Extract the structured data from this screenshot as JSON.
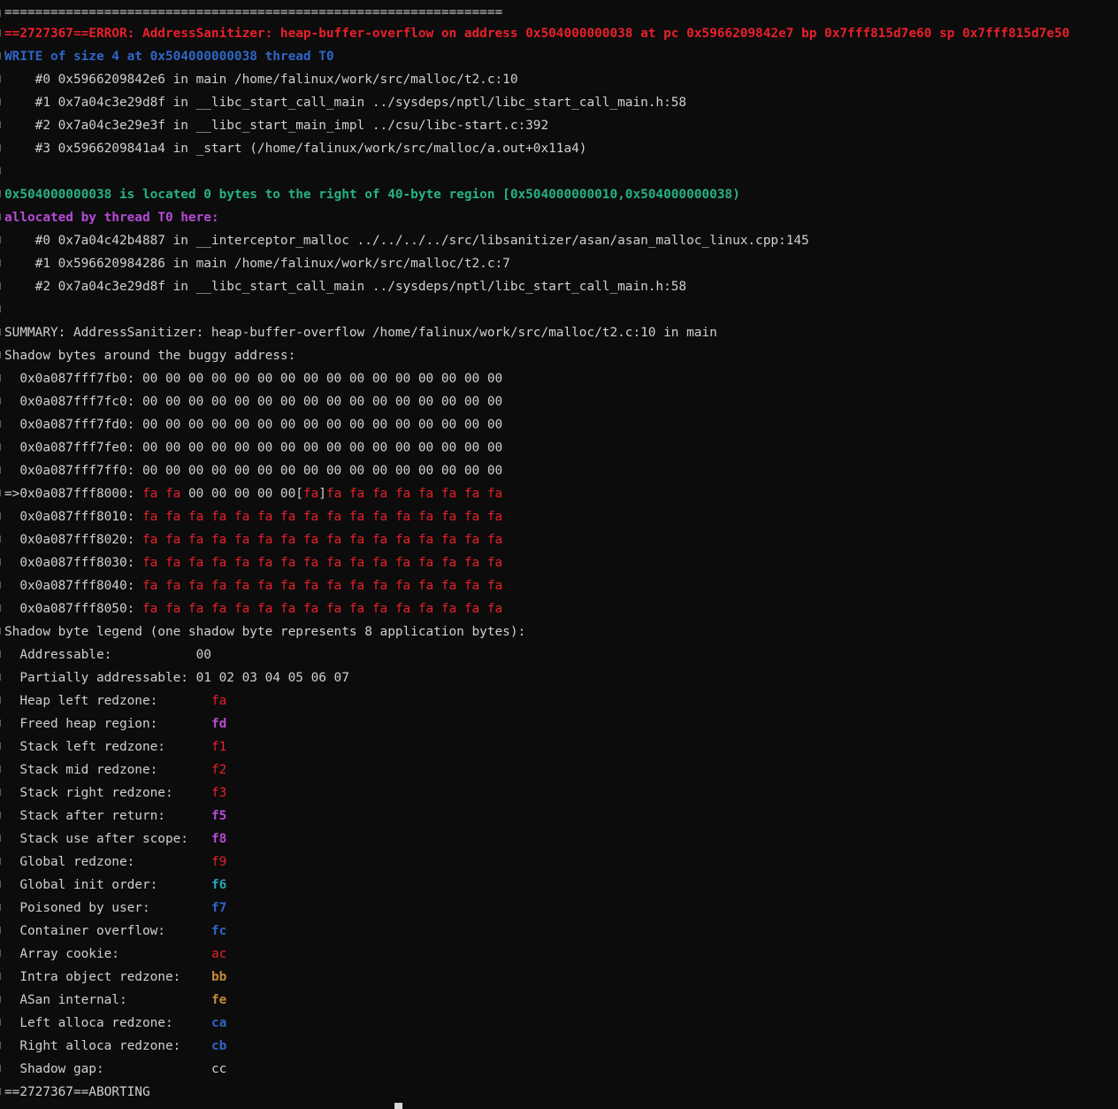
{
  "separator": "=================================================================",
  "error_header": "==2727367==ERROR: AddressSanitizer: heap-buffer-overflow on address 0x504000000038 at pc 0x5966209842e7 bp 0x7fff815d7e60 sp 0x7fff815d7e50",
  "write_line": "WRITE of size 4 at 0x504000000038 thread T0",
  "write_stack": [
    "    #0 0x5966209842e6 in main /home/falinux/work/src/malloc/t2.c:10",
    "    #1 0x7a04c3e29d8f in __libc_start_call_main ../sysdeps/nptl/libc_start_call_main.h:58",
    "    #2 0x7a04c3e29e3f in __libc_start_main_impl ../csu/libc-start.c:392",
    "    #3 0x5966209841a4 in _start (/home/falinux/work/src/malloc/a.out+0x11a4)"
  ],
  "located_line": "0x504000000038 is located 0 bytes to the right of 40-byte region [0x504000000010,0x504000000038)",
  "allocated_line": "allocated by thread T0 here:",
  "alloc_stack": [
    "    #0 0x7a04c42b4887 in __interceptor_malloc ../../../../src/libsanitizer/asan/asan_malloc_linux.cpp:145",
    "    #1 0x596620984286 in main /home/falinux/work/src/malloc/t2.c:7",
    "    #2 0x7a04c3e29d8f in __libc_start_call_main ../sysdeps/nptl/libc_start_call_main.h:58"
  ],
  "summary": "SUMMARY: AddressSanitizer: heap-buffer-overflow /home/falinux/work/src/malloc/t2.c:10 in main",
  "shadow_title": "Shadow bytes around the buggy address:",
  "shadow_zero_rows": [
    "  0x0a087fff7fb0: 00 00 00 00 00 00 00 00 00 00 00 00 00 00 00 00",
    "  0x0a087fff7fc0: 00 00 00 00 00 00 00 00 00 00 00 00 00 00 00 00",
    "  0x0a087fff7fd0: 00 00 00 00 00 00 00 00 00 00 00 00 00 00 00 00",
    "  0x0a087fff7fe0: 00 00 00 00 00 00 00 00 00 00 00 00 00 00 00 00",
    "  0x0a087fff7ff0: 00 00 00 00 00 00 00 00 00 00 00 00 00 00 00 00"
  ],
  "buggy_row": {
    "prefix": "=>0x0a087fff8000: ",
    "fa_start": "fa fa",
    "zeros": " 00 00 00 00 00[",
    "hit": "fa",
    "bracket": "]",
    "fa_rest": "fa fa fa fa fa fa fa fa"
  },
  "shadow_fa_rows": [
    {
      "addr": "  0x0a087fff8010: ",
      "bytes": "fa fa fa fa fa fa fa fa fa fa fa fa fa fa fa fa"
    },
    {
      "addr": "  0x0a087fff8020: ",
      "bytes": "fa fa fa fa fa fa fa fa fa fa fa fa fa fa fa fa"
    },
    {
      "addr": "  0x0a087fff8030: ",
      "bytes": "fa fa fa fa fa fa fa fa fa fa fa fa fa fa fa fa"
    },
    {
      "addr": "  0x0a087fff8040: ",
      "bytes": "fa fa fa fa fa fa fa fa fa fa fa fa fa fa fa fa"
    },
    {
      "addr": "  0x0a087fff8050: ",
      "bytes": "fa fa fa fa fa fa fa fa fa fa fa fa fa fa fa fa"
    }
  ],
  "legend_title": "Shadow byte legend (one shadow byte represents 8 application bytes):",
  "legend": [
    {
      "label": "  Addressable:           ",
      "code": "00",
      "color": "plain"
    },
    {
      "label": "  Partially addressable: ",
      "code": "01 02 03 04 05 06 07",
      "color": "plain"
    },
    {
      "label": "  Heap left redzone:       ",
      "code": "fa",
      "color": "red"
    },
    {
      "label": "  Freed heap region:       ",
      "code": "fd",
      "color": "purple"
    },
    {
      "label": "  Stack left redzone:      ",
      "code": "f1",
      "color": "red"
    },
    {
      "label": "  Stack mid redzone:       ",
      "code": "f2",
      "color": "red"
    },
    {
      "label": "  Stack right redzone:     ",
      "code": "f3",
      "color": "red"
    },
    {
      "label": "  Stack after return:      ",
      "code": "f5",
      "color": "purple"
    },
    {
      "label": "  Stack use after scope:   ",
      "code": "f8",
      "color": "purple"
    },
    {
      "label": "  Global redzone:          ",
      "code": "f9",
      "color": "red"
    },
    {
      "label": "  Global init order:       ",
      "code": "f6",
      "color": "teal"
    },
    {
      "label": "  Poisoned by user:        ",
      "code": "f7",
      "color": "dblue"
    },
    {
      "label": "  Container overflow:      ",
      "code": "fc",
      "color": "dblue"
    },
    {
      "label": "  Array cookie:            ",
      "code": "ac",
      "color": "red"
    },
    {
      "label": "  Intra object redzone:    ",
      "code": "bb",
      "color": "tan"
    },
    {
      "label": "  ASan internal:           ",
      "code": "fe",
      "color": "tan"
    },
    {
      "label": "  Left alloca redzone:     ",
      "code": "ca",
      "color": "dblue"
    },
    {
      "label": "  Right alloca redzone:    ",
      "code": "cb",
      "color": "dblue"
    },
    {
      "label": "  Shadow gap:              ",
      "code": "cc",
      "color": "plain"
    }
  ],
  "aborting": "==2727367==ABORTING",
  "colors": {
    "background": "#0c0c0c",
    "text": "#d0d0d0",
    "error_red": "#e8202a",
    "write_blue": "#2f66c8",
    "located_green": "#27b280",
    "allocated_purple": "#b54bd6"
  }
}
